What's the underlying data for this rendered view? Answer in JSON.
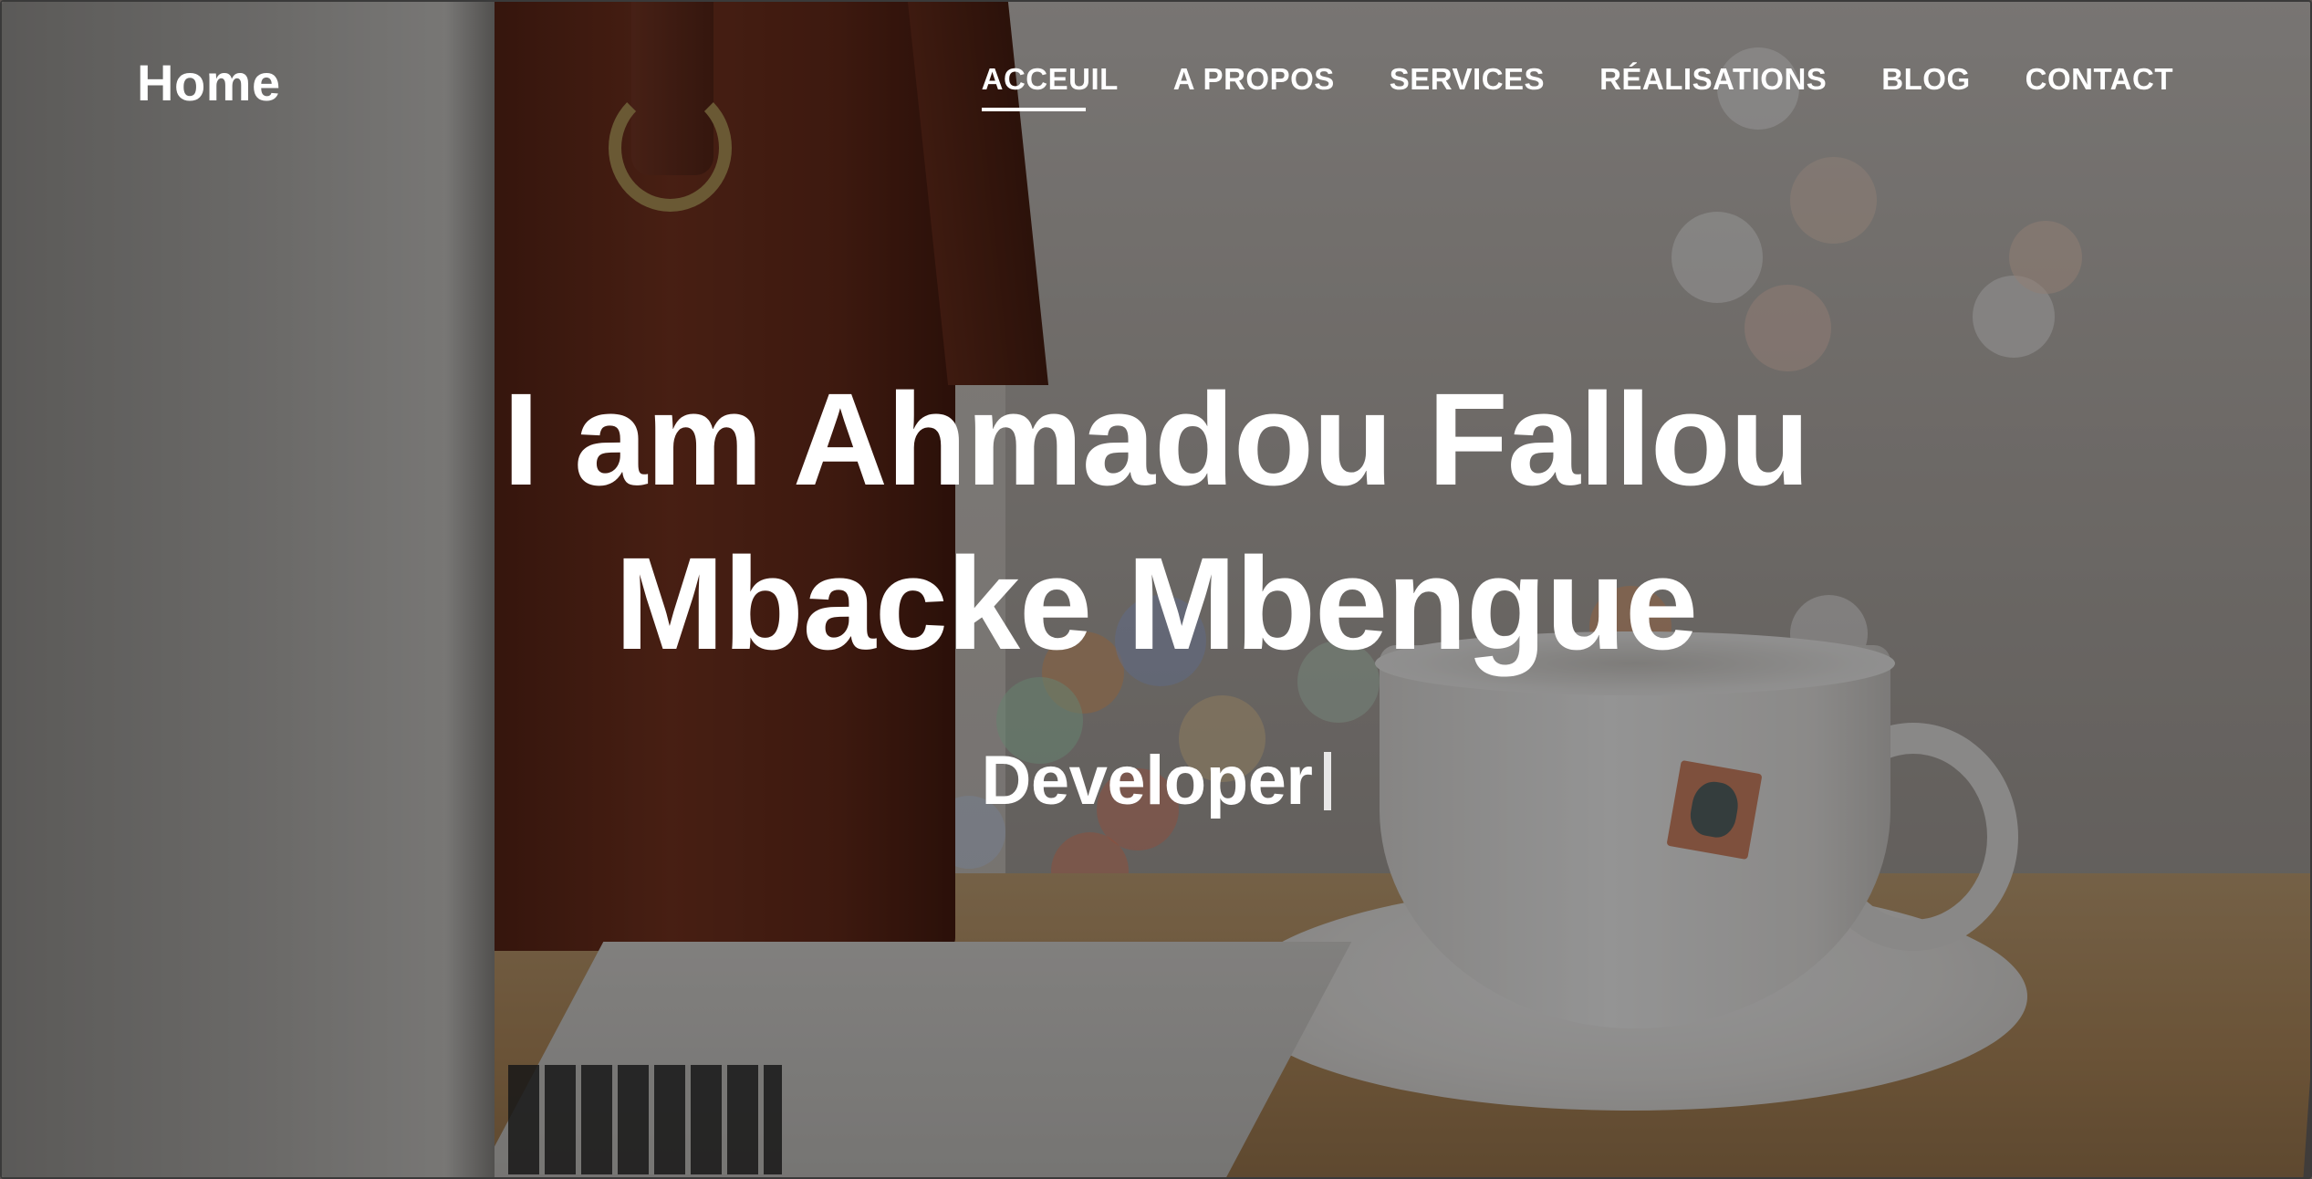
{
  "brand": {
    "label": "Home"
  },
  "nav": {
    "items": [
      {
        "label": "ACCEUIL",
        "active": true
      },
      {
        "label": "A PROPOS",
        "active": false
      },
      {
        "label": "SERVICES",
        "active": false
      },
      {
        "label": "RÉALISATIONS",
        "active": false
      },
      {
        "label": "BLOG",
        "active": false
      },
      {
        "label": "CONTACT",
        "active": false
      }
    ]
  },
  "hero": {
    "title": "I am Ahmadou Fallou Mbacke Mbengue",
    "subtitle": "Developer",
    "cursor": "|"
  },
  "colors": {
    "text": "#ffffff",
    "overlay": "rgba(0,0,0,0.42)"
  }
}
